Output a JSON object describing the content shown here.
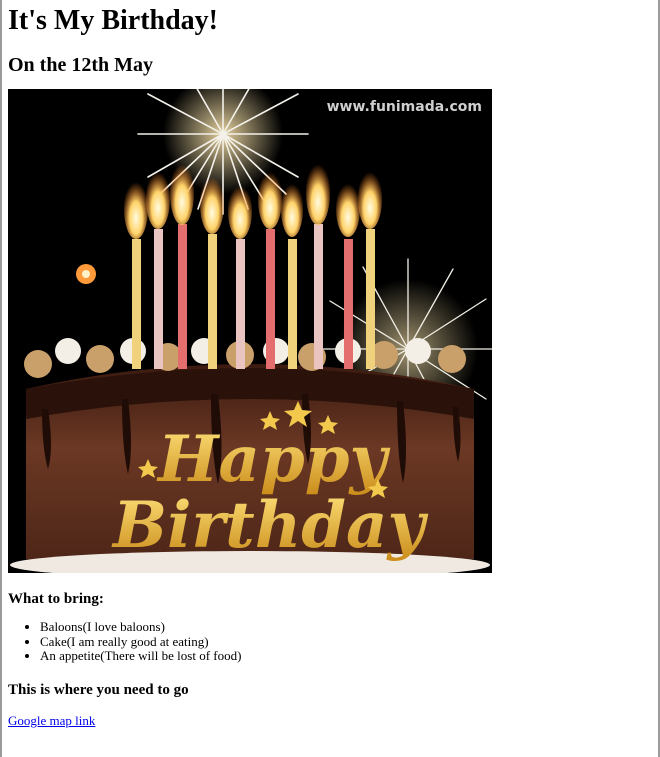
{
  "page": {
    "title": "It's My Birthday!",
    "date_heading": "On the 12th May"
  },
  "image": {
    "watermark": "www.funimada.com",
    "script_line1": "Happy",
    "script_line2": "Birthday",
    "colors": {
      "background": "#000000",
      "cake": "#5a2e1c",
      "gold": "#e8b534",
      "candle_red": "#d24a4a",
      "flame": "#ffd36a"
    }
  },
  "bring": {
    "heading": "What to bring:",
    "items": [
      "Baloons(I love baloons)",
      "Cake(I am really good at eating)",
      "An appetite(There will be lost of food)"
    ]
  },
  "directions": {
    "heading": "This is where you need to go",
    "link_text": "Google map link"
  }
}
